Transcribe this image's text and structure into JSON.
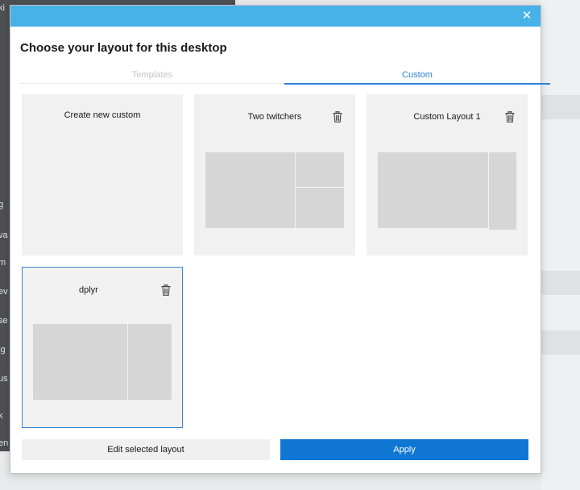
{
  "background": {
    "fragments": [
      "ki",
      "g",
      "va",
      "m",
      "ev",
      "se",
      "ig",
      "us",
      "k",
      "en"
    ]
  },
  "dialog": {
    "close_icon": "close-icon",
    "title": "Choose your layout for this desktop",
    "tabs": [
      {
        "label": "Templates",
        "active": false
      },
      {
        "label": "Custom",
        "active": true
      }
    ],
    "cards": [
      {
        "title": "Create new custom",
        "has_delete": false,
        "preview": "none",
        "selected": false
      },
      {
        "title": "Two twitchers",
        "has_delete": true,
        "preview": "left-large-right-stacked",
        "selected": false
      },
      {
        "title": "Custom Layout 1",
        "has_delete": true,
        "preview": "left-large-right-narrow",
        "selected": false
      },
      {
        "title": "dplyr",
        "has_delete": true,
        "preview": "left-large-right-column",
        "selected": true
      }
    ],
    "buttons": {
      "edit": "Edit selected layout",
      "apply": "Apply"
    }
  },
  "colors": {
    "titlebar": "#47b2e8",
    "accent": "#2a82d7",
    "apply_button": "#0f77d3",
    "card_background": "#f1f1f1",
    "zone": "#d6d6d6"
  }
}
